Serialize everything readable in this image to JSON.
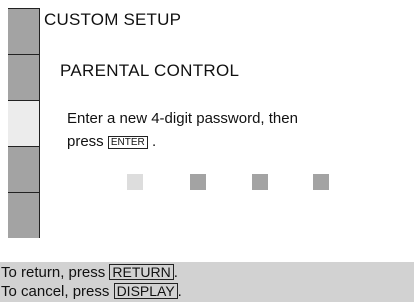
{
  "screen": {
    "title": "CUSTOM SETUP",
    "subtitle": "PARENTAL CONTROL",
    "instruction_line1": "Enter a new 4-digit password, then",
    "instruction_prefix": "press",
    "instruction_key": "ENTER",
    "instruction_suffix": "."
  },
  "sidebar": {
    "tab_count": 5,
    "active_index": 2
  },
  "password": {
    "digit_count": 4,
    "current_index": 0
  },
  "footer": {
    "return_prefix": "To return, press",
    "return_key": "RETURN",
    "return_suffix": ".",
    "cancel_prefix": "To cancel, press",
    "cancel_key": "DISPLAY",
    "cancel_suffix": "."
  },
  "colors": {
    "tab_inactive": "#a3a3a3",
    "tab_active": "#ececec",
    "footer_bg": "#d2d2d2",
    "box_current": "#dddddd",
    "box_empty": "#a3a3a3"
  }
}
